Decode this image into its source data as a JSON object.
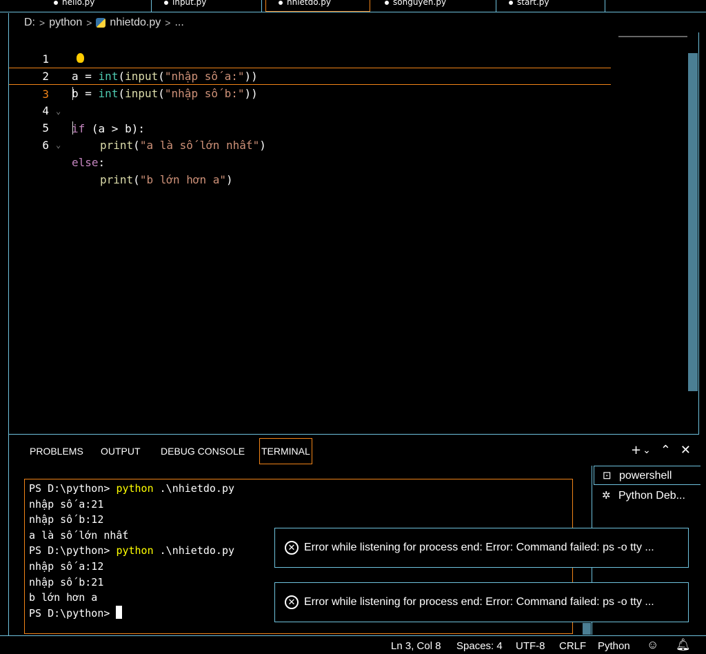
{
  "tabs": [
    {
      "label": "hello.py"
    },
    {
      "label": "input.py"
    },
    {
      "label": "nhietdo.py",
      "active": true
    },
    {
      "label": "songuyen.py"
    },
    {
      "label": "start.py"
    }
  ],
  "breadcrumb": {
    "drive": "D:",
    "folder": "python",
    "file": "nhietdo.py",
    "more": "..."
  },
  "editor": {
    "lines": [
      {
        "num": "1"
      },
      {
        "num": "2"
      },
      {
        "num": "3"
      },
      {
        "num": "4"
      },
      {
        "num": "5"
      },
      {
        "num": "6"
      }
    ],
    "code": {
      "l1_var": "a",
      "l1_eq": " = ",
      "l1_int": "int",
      "l1_paren1": "(",
      "l1_input": "input",
      "l1_paren2": "(",
      "l1_str": "\"nhập số a:\"",
      "l1_close": "))",
      "l2_var": "b",
      "l2_eq": " = ",
      "l2_int": "int",
      "l2_paren1": "(",
      "l2_input": "input",
      "l2_paren2": "(",
      "l2_str": "\"nhập số b:\"",
      "l2_close": "))",
      "l3_if": "if",
      "l3_rest": " (a > b):",
      "l4_print": "print",
      "l4_open": "(",
      "l4_str": "\"a là số lớn nhất\"",
      "l4_close": ")",
      "l5_else": "else",
      "l5_colon": ":",
      "l6_print": "print",
      "l6_open": "(",
      "l6_str": "\"b lớn hơn a\"",
      "l6_close": ")"
    },
    "fold_glyph": "⌄"
  },
  "panel": {
    "tabs": {
      "problems": "PROBLEMS",
      "output": "OUTPUT",
      "debug": "DEBUG CONSOLE",
      "terminal": "TERMINAL"
    },
    "actions": {
      "add": "+",
      "dropdown": "⌄",
      "maximize": "⌃",
      "close": "✕"
    }
  },
  "terminal": {
    "lines": [
      {
        "prompt": "PS D:\\python> ",
        "cmd": "python",
        "args": " .\\nhietdo.py"
      },
      {
        "text": "nhập số a:21"
      },
      {
        "text": "nhập số b:12"
      },
      {
        "text": "a là số lớn nhất"
      },
      {
        "prompt": "PS D:\\python> ",
        "cmd": "python",
        "args": " .\\nhietdo.py"
      },
      {
        "text": "nhập số a:12"
      },
      {
        "text": "nhập số b:21"
      },
      {
        "text": "b lớn hơn a"
      },
      {
        "prompt": "PS D:\\python> "
      }
    ],
    "instances": [
      {
        "label": "powershell",
        "icon": "terminal-icon"
      },
      {
        "label": "Python Deb...",
        "icon": "debug-icon"
      }
    ]
  },
  "notifications": [
    {
      "message": "Error while listening for process end: Error: Command failed: ps -o tty ..."
    },
    {
      "message": "Error while listening for process end: Error: Command failed: ps -o tty ..."
    }
  ],
  "statusbar": {
    "position": "Ln 3, Col 8",
    "spaces": "Spaces: 4",
    "encoding": "UTF-8",
    "eol": "CRLF",
    "language": "Python"
  },
  "colors": {
    "border": "#6fc3df",
    "focus": "#f38518",
    "keyword": "#c586c0",
    "function": "#dcdcaa",
    "builtin": "#4ec9b0",
    "string": "#ce9178",
    "terminal_cmd": "#ffff00"
  }
}
